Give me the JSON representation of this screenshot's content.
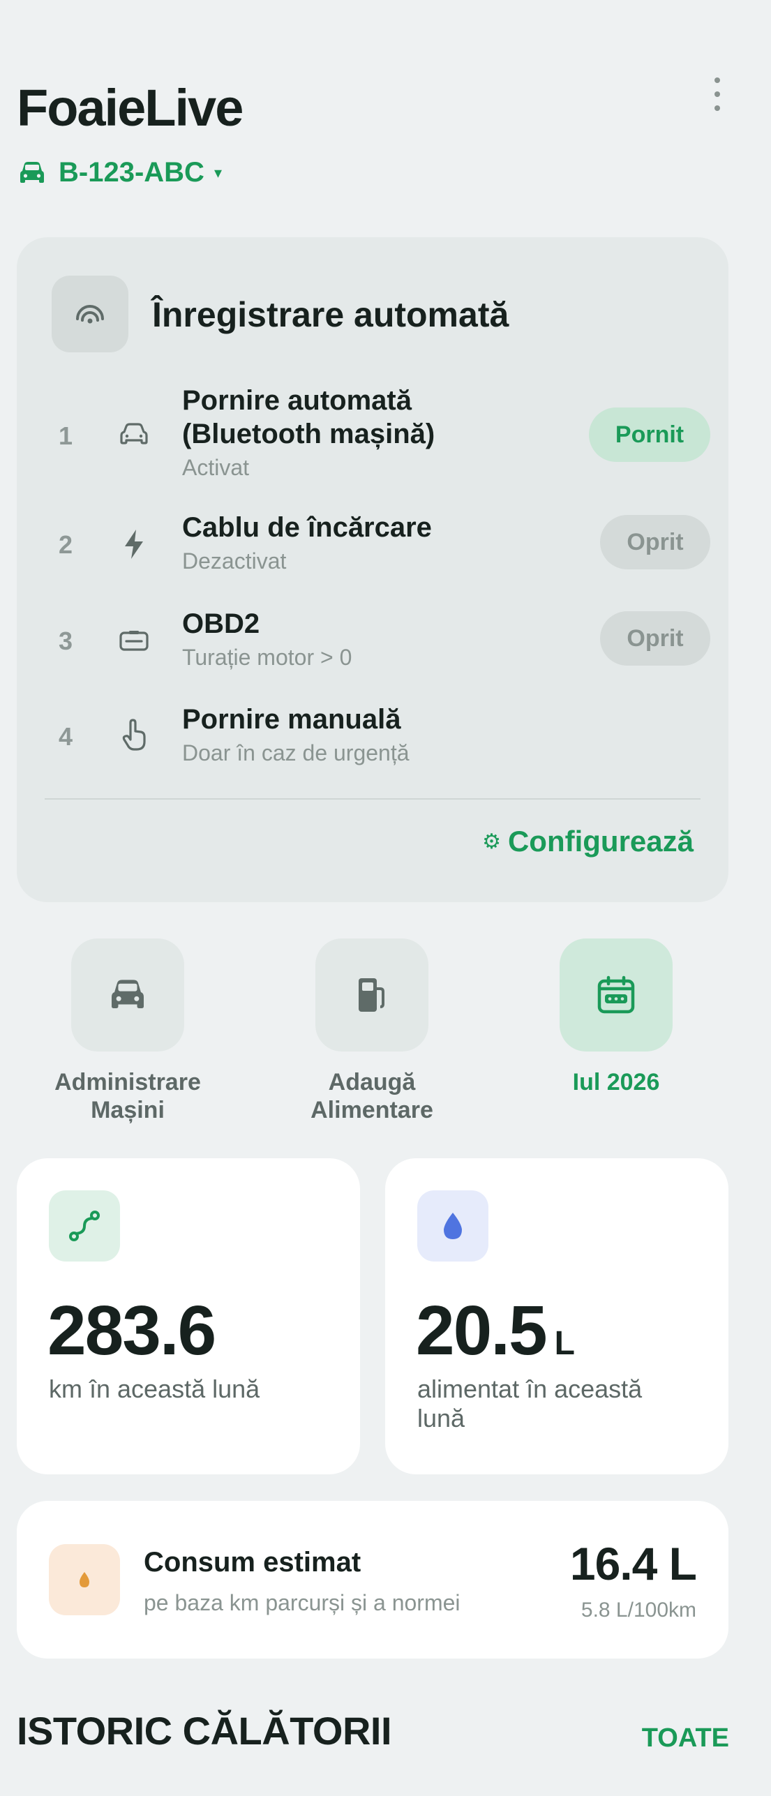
{
  "app": {
    "title": "FoaieLive"
  },
  "vehicle": {
    "plate": "B-123-ABC",
    "caret": "▾"
  },
  "auto_record": {
    "title": "Înregistrare automată",
    "rows": [
      {
        "num": "1",
        "title_line1": "Pornire automată",
        "title_line2": "(Bluetooth mașină)",
        "subtitle": "Activat",
        "toggle": "Pornit",
        "icon": "car-outline-icon"
      },
      {
        "num": "2",
        "title_line1": "Cablu de încărcare",
        "subtitle": "Dezactivat",
        "toggle": "Oprit",
        "icon": "bolt-icon"
      },
      {
        "num": "3",
        "title_line1": "OBD2",
        "subtitle": "Turație motor > 0",
        "toggle": "Oprit",
        "icon": "obd-port-icon"
      },
      {
        "num": "4",
        "title_line1": "Pornire manuală",
        "subtitle": "Doar în caz de urgență",
        "icon": "hand-pointer-icon"
      }
    ],
    "configure_icon": "⚙",
    "configure_label": "Configurează"
  },
  "quick_actions": [
    {
      "label_line1": "Administrare",
      "label_line2": "Mașini",
      "icon": "car-icon"
    },
    {
      "label_line1": "Adaugă Alimentare",
      "icon": "fuel-pump-icon"
    },
    {
      "label_line1": "Iul 2026",
      "icon": "calendar-icon",
      "active": true
    }
  ],
  "stats": {
    "distance": {
      "value": "283.6",
      "label": "km în această lună",
      "icon": "route-icon"
    },
    "fuel": {
      "value": "20.5",
      "unit": "L",
      "label_line1": "alimentat în această",
      "label_line2": "lună",
      "icon": "water-drop-icon"
    }
  },
  "consumption": {
    "title": "Consum estimat",
    "subtitle": "pe baza km parcurși și a normei",
    "value": "16.4 L",
    "rate": "5.8 L/100km",
    "icon": "small-drop-icon"
  },
  "history": {
    "title": "ISTORIC CĂLĂTORII",
    "all_label": "TOATE"
  },
  "colors": {
    "accent": "#1a9a58",
    "background": "#eef1f2",
    "card_gray": "#e4e9e9",
    "fuel_blue": "#4f74e0",
    "warm_orange": "#e39a3a"
  }
}
